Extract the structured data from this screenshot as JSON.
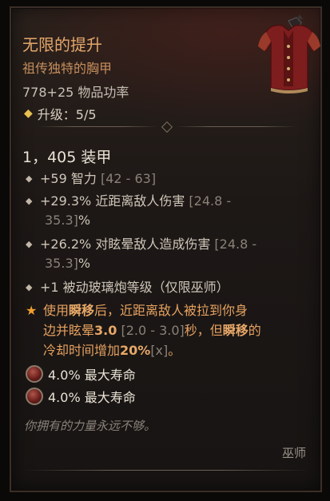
{
  "item": {
    "name": "无限的提升",
    "type": "祖传独特的胸甲",
    "power": "778+25 物品功率",
    "upgrade": "升级：5/5"
  },
  "stats": {
    "armor": "1，405 装甲"
  },
  "affixes": [
    {
      "value": "+59 智力 ",
      "range": "[42 - 63]",
      "cont": ""
    },
    {
      "value": "+29.3% 近距离敌人伤害 ",
      "range": "[24.8 -",
      "cont_range": "35.3]",
      "cont": "%"
    },
    {
      "value": "+26.2% 对眩晕敌人造成伤害 ",
      "range": "[24.8 -",
      "cont_range": "35.3]",
      "cont": "%"
    },
    {
      "value": "+1 被动玻璃炮等级（仅限巫师）",
      "range": "",
      "cont": ""
    }
  ],
  "unique_power": {
    "p1": "使用",
    "hl1": "瞬移",
    "p2": "后，近距离敌人被拉到你身",
    "p3": "边并眩晕",
    "hl2": "3.0",
    "range1": " [2.0 - 3.0]",
    "p4": "秒，但",
    "hl3": "瞬移",
    "p5": "的",
    "p6": "冷却时间增加",
    "hl4": "20%",
    "range2": "[x]",
    "p7": "。"
  },
  "sockets": [
    {
      "text": "4.0% 最大寿命"
    },
    {
      "text": "4.0% 最大寿命"
    }
  ],
  "flavor": "你拥有的力量永远不够。",
  "class_requirement": "巫师",
  "colors": {
    "title": "#e3a76b",
    "unique_power": "#e6a160",
    "range": "#8a8177"
  }
}
